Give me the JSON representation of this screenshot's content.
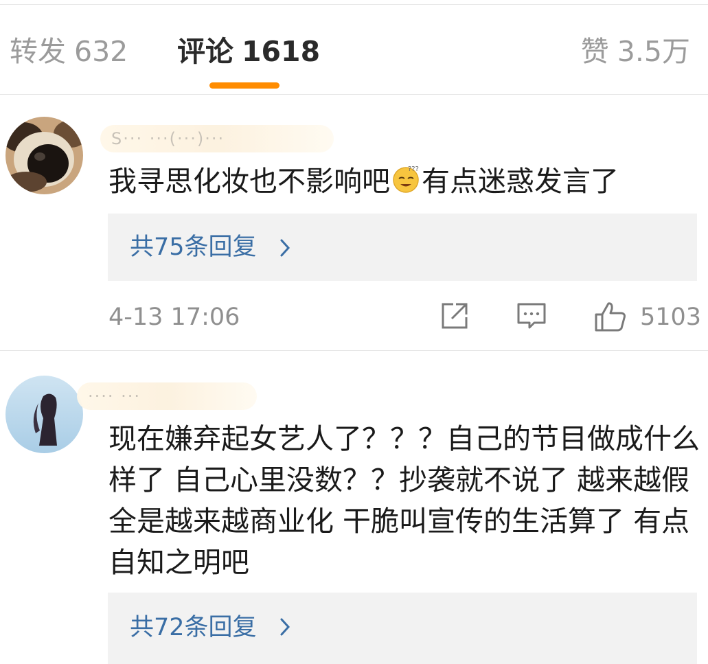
{
  "tabs": {
    "repost": {
      "label": "转发",
      "count": "632"
    },
    "comments": {
      "label": "评论",
      "count": "1618"
    },
    "likes": {
      "label": "赞",
      "count": "3.5万"
    }
  },
  "accent_color": "#ff8c00",
  "link_color": "#3a6ea5",
  "comments": [
    {
      "username_obscured": "S··· ···(···)···",
      "text_before_emoji": "我寻思化妆也不影响吧",
      "emoji": "sweat-smile-face-icon",
      "text_after_emoji": "有点迷惑发言了",
      "replies_label": "共75条回复",
      "time": "4-13 17:06",
      "like_count": "5103"
    },
    {
      "username_obscured": "···· ···",
      "text": "现在嫌弃起女艺人了？？？自己的节目做成什么样了 自己心里没数？？抄袭就不说了 越来越假  全是越来越商业化 干脆叫宣传的生活算了 有点自知之明吧",
      "replies_label": "共72条回复"
    }
  ]
}
